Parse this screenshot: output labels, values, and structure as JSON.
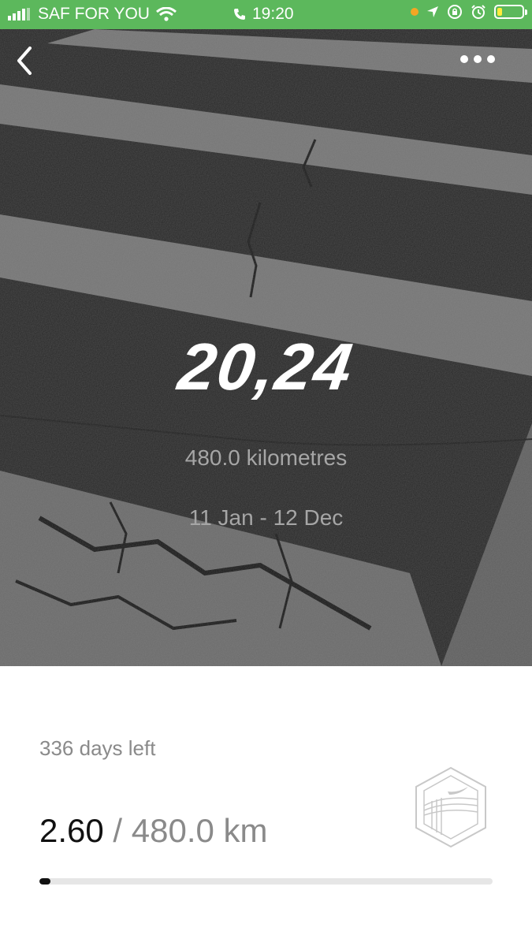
{
  "status_bar": {
    "carrier": "SAF FOR YOU",
    "time": "19:20",
    "icons": [
      "signal-icon",
      "wifi-icon",
      "phone-icon",
      "location-icon",
      "lock-rotation-icon",
      "alarm-icon",
      "battery-icon"
    ],
    "battery_color": "#ffeb3b",
    "background_color": "#5cb85c"
  },
  "hero": {
    "title": "20,24",
    "distance": "480.0 kilometres",
    "date_range": "11 Jan - 12 Dec"
  },
  "progress": {
    "days_left": "336 days left",
    "current": "2.60",
    "separator_and_target": " / 480.0 km",
    "fraction": 0.0054
  },
  "badge": {
    "icon": "nike-goal-badge-icon"
  }
}
